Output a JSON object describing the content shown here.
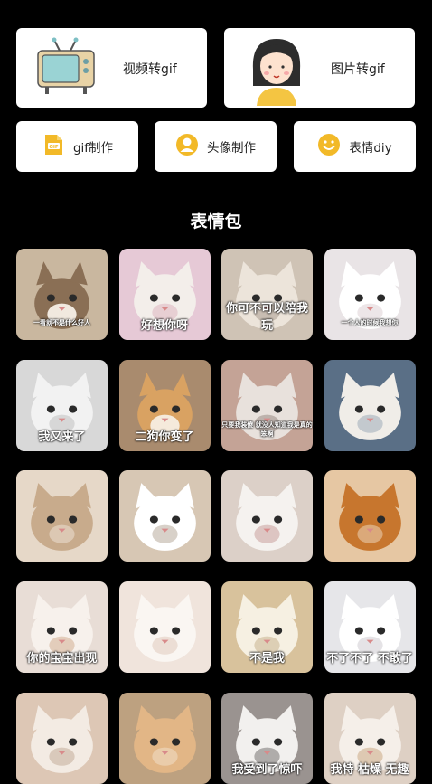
{
  "feature_cards": [
    {
      "label": "视频转gif",
      "icon": "tv-icon"
    },
    {
      "label": "图片转gif",
      "icon": "girl-avatar-icon"
    }
  ],
  "tools": [
    {
      "label": "gif制作",
      "icon": "gif-file-icon"
    },
    {
      "label": "头像制作",
      "icon": "avatar-icon"
    },
    {
      "label": "表情diy",
      "icon": "smiley-icon"
    }
  ],
  "section_title": "表情包",
  "stickers": [
    {
      "caption": "一看就不是什么好人",
      "palette": [
        "#c9b79f",
        "#8a6f55",
        "#f1e9df"
      ],
      "animal": "dog"
    },
    {
      "caption": "好想你呀",
      "palette": [
        "#e6c9d6",
        "#f3eeea",
        "#d9a9b7"
      ],
      "animal": "cat"
    },
    {
      "caption": "你可不可以陪我玩",
      "palette": [
        "#cfc3b5",
        "#ece4da",
        "#9d8f80"
      ],
      "animal": "cat"
    },
    {
      "caption": "一个人的时候我想你",
      "palette": [
        "#e9e4e6",
        "#ffffff",
        "#d8c7cd"
      ],
      "animal": "cat"
    },
    {
      "caption": "我又来了",
      "palette": [
        "#d8d8d8",
        "#f2f2f2",
        "#b5b5b5"
      ],
      "animal": "cat"
    },
    {
      "caption": "二狗你变了",
      "palette": [
        "#a98b6e",
        "#d9a262",
        "#f5eadb"
      ],
      "animal": "dog"
    },
    {
      "caption": "只要我装傻 就没人知道我是真的笨啊",
      "palette": [
        "#c4a396",
        "#e8e1dc",
        "#8a7a70"
      ],
      "animal": "cat"
    },
    {
      "caption": "",
      "palette": [
        "#5a6f86",
        "#f0ede8",
        "#8b9db0"
      ],
      "animal": "cat"
    },
    {
      "caption": "",
      "palette": [
        "#e6d8c8",
        "#c8ab8c",
        "#f4ece2"
      ],
      "animal": "cat"
    },
    {
      "caption": "",
      "palette": [
        "#d7c7b4",
        "#ffffff",
        "#a89988"
      ],
      "animal": "cat"
    },
    {
      "caption": "",
      "palette": [
        "#dcd0c8",
        "#f5f2ef",
        "#c08e8c"
      ],
      "animal": "cat"
    },
    {
      "caption": "",
      "palette": [
        "#e6c7a3",
        "#c7762e",
        "#f4e8d8"
      ],
      "animal": "cat"
    },
    {
      "caption": "你的宝宝出现",
      "palette": [
        "#e8ddd6",
        "#f7f1ec",
        "#c9a181"
      ],
      "animal": "cat"
    },
    {
      "caption": "",
      "palette": [
        "#f0e4dc",
        "#faf6f2",
        "#dcc2b2"
      ],
      "animal": "cat"
    },
    {
      "caption": "不是我",
      "palette": [
        "#d8c29c",
        "#f6f0e2",
        "#bfa77e"
      ],
      "animal": "cat"
    },
    {
      "caption": "不了不了 不敢了",
      "palette": [
        "#e6e6e9",
        "#ffffff",
        "#c5c2c7"
      ],
      "animal": "cat"
    },
    {
      "caption": "",
      "palette": [
        "#ddc7b5",
        "#f3ebe3",
        "#bba08a"
      ],
      "animal": "cat"
    },
    {
      "caption": "",
      "palette": [
        "#bda180",
        "#e2b686",
        "#f3e6d6"
      ],
      "animal": "cat"
    },
    {
      "caption": "我受到了惊吓",
      "palette": [
        "#9a9390",
        "#f2f0ee",
        "#5d5856"
      ],
      "animal": "cat"
    },
    {
      "caption": "我特 枯燥 无趣",
      "palette": [
        "#ded0c4",
        "#f5efe9",
        "#c39b6e"
      ],
      "animal": "cat"
    }
  ]
}
